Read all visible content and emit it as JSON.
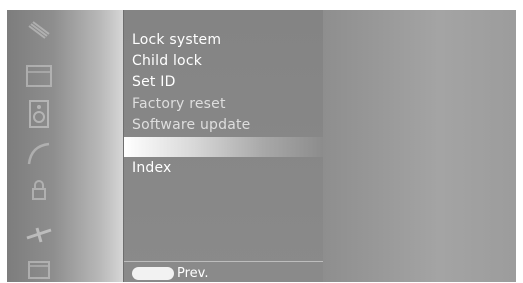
{
  "menu": {
    "items": [
      {
        "label": "Lock system",
        "icon": "lock-icon"
      },
      {
        "label": "Child lock",
        "icon": "child-icon"
      },
      {
        "label": "Set ID",
        "icon": "id-icon"
      },
      {
        "label": "Factory reset",
        "icon": "reset-icon"
      },
      {
        "label": "Software update",
        "icon": "update-icon"
      },
      {
        "label": "",
        "icon": "blank"
      },
      {
        "label": "Index",
        "icon": "index-icon"
      }
    ],
    "highlighted_index": 5
  },
  "footer": {
    "prev_label": "Prev."
  },
  "sidebar_icons": [
    "tv-icon",
    "picture-icon",
    "speaker-icon",
    "clock-icon",
    "lock-icon",
    "tools-icon",
    "source-icon"
  ]
}
